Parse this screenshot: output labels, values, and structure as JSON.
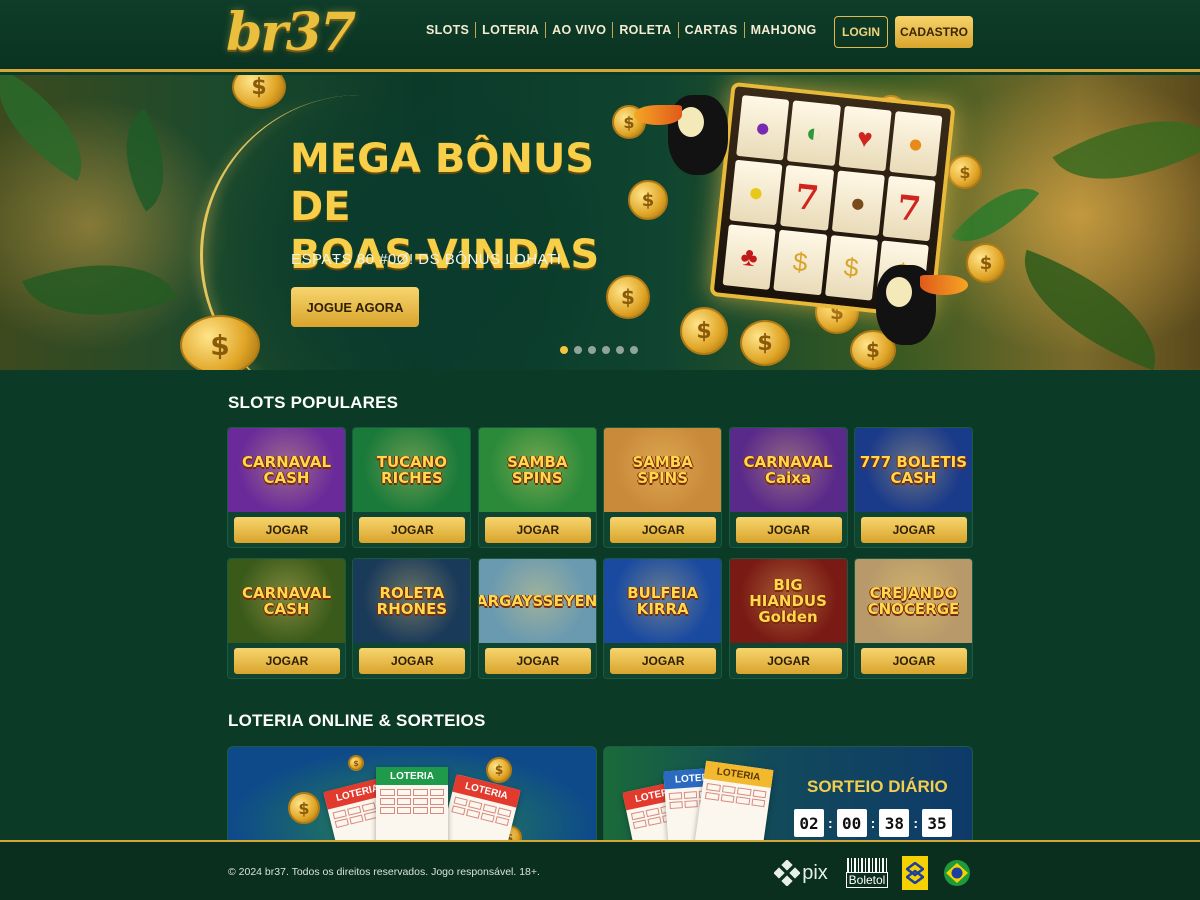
{
  "header": {
    "logo": "br37",
    "nav": [
      "SLOTS",
      "LOTERIA",
      "AO VIVO",
      "ROLETA",
      "CARTAS",
      "MAHJONG"
    ],
    "login_label": "LOGIN",
    "signup_label": "CADASTRO"
  },
  "hero": {
    "title_line1": "MEGA BÔNUS DE",
    "title_line2": "BOAS-VINDAS",
    "subtitle": "ESPAŦS 80 #0Ø! DS BÔNUS LOHATI",
    "cta_label": "JOGUE AGORA",
    "slide_count": 6,
    "active_slide": 1
  },
  "slots_section": {
    "title": "SLOTS POPULARES",
    "play_label": "JOGAR",
    "games": [
      {
        "name": "CARNAVAL CASH",
        "bg": "#6a2a9a"
      },
      {
        "name": "TUCANO RICHES",
        "bg": "#1a7a3a"
      },
      {
        "name": "SAMBA SPINS",
        "bg": "#2a8a3a"
      },
      {
        "name": "SAMBA SPINS",
        "bg": "#c98a3a"
      },
      {
        "name": "CARNAVAL Caixa",
        "bg": "#5a2a8a"
      },
      {
        "name": "777 BOLETIS CASH",
        "bg": "#1a3a8a"
      },
      {
        "name": "CARNAVAL CASH",
        "bg": "#3a5a1a"
      },
      {
        "name": "ROLETA RHONES",
        "bg": "#1a3a5a"
      },
      {
        "name": "PARGAYSSEYENS",
        "bg": "#6a9ab0"
      },
      {
        "name": "BULFEIA KIRRA",
        "bg": "#1a4aa0"
      },
      {
        "name": "BIG HIANDUS Golden",
        "bg": "#7a1a14"
      },
      {
        "name": "CREJANDO CNOCERGE",
        "bg": "#b89a6a"
      }
    ]
  },
  "lottery_section": {
    "title": "LOTERIA ONLINE & SORTEIOS",
    "ticket_label": "LOTERIA",
    "ticket_label_tilted": "LOTERIA",
    "draw_title": "SORTEIO DIÁRIO",
    "timer": [
      "02",
      "00",
      "38",
      "35"
    ]
  },
  "footer": {
    "copyright": "© 2024 br37. Todos os direitos reservados. Jogo responsável. 18+.",
    "payments": [
      "pix",
      "Boletol"
    ]
  },
  "colors": {
    "accent_gold": "#f3c63e",
    "background_green": "#0b3a26"
  }
}
